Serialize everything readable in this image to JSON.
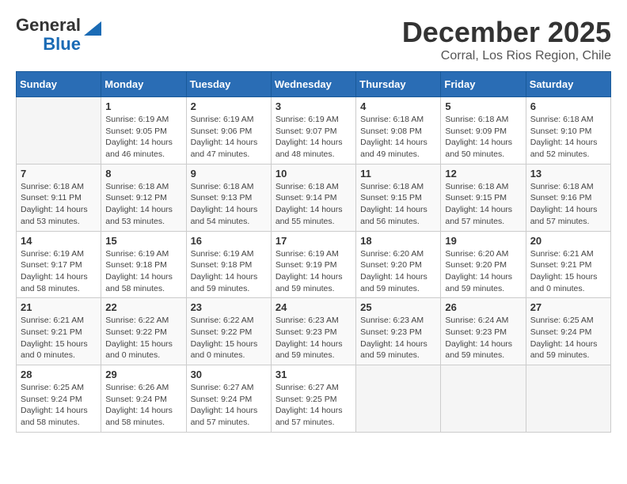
{
  "logo": {
    "line1": "General",
    "line2": "Blue"
  },
  "title": "December 2025",
  "location": "Corral, Los Rios Region, Chile",
  "days_of_week": [
    "Sunday",
    "Monday",
    "Tuesday",
    "Wednesday",
    "Thursday",
    "Friday",
    "Saturday"
  ],
  "weeks": [
    [
      {
        "day": "",
        "sunrise": "",
        "sunset": "",
        "daylight": ""
      },
      {
        "day": "1",
        "sunrise": "Sunrise: 6:19 AM",
        "sunset": "Sunset: 9:05 PM",
        "daylight": "Daylight: 14 hours and 46 minutes."
      },
      {
        "day": "2",
        "sunrise": "Sunrise: 6:19 AM",
        "sunset": "Sunset: 9:06 PM",
        "daylight": "Daylight: 14 hours and 47 minutes."
      },
      {
        "day": "3",
        "sunrise": "Sunrise: 6:19 AM",
        "sunset": "Sunset: 9:07 PM",
        "daylight": "Daylight: 14 hours and 48 minutes."
      },
      {
        "day": "4",
        "sunrise": "Sunrise: 6:18 AM",
        "sunset": "Sunset: 9:08 PM",
        "daylight": "Daylight: 14 hours and 49 minutes."
      },
      {
        "day": "5",
        "sunrise": "Sunrise: 6:18 AM",
        "sunset": "Sunset: 9:09 PM",
        "daylight": "Daylight: 14 hours and 50 minutes."
      },
      {
        "day": "6",
        "sunrise": "Sunrise: 6:18 AM",
        "sunset": "Sunset: 9:10 PM",
        "daylight": "Daylight: 14 hours and 52 minutes."
      }
    ],
    [
      {
        "day": "7",
        "sunrise": "Sunrise: 6:18 AM",
        "sunset": "Sunset: 9:11 PM",
        "daylight": "Daylight: 14 hours and 53 minutes."
      },
      {
        "day": "8",
        "sunrise": "Sunrise: 6:18 AM",
        "sunset": "Sunset: 9:12 PM",
        "daylight": "Daylight: 14 hours and 53 minutes."
      },
      {
        "day": "9",
        "sunrise": "Sunrise: 6:18 AM",
        "sunset": "Sunset: 9:13 PM",
        "daylight": "Daylight: 14 hours and 54 minutes."
      },
      {
        "day": "10",
        "sunrise": "Sunrise: 6:18 AM",
        "sunset": "Sunset: 9:14 PM",
        "daylight": "Daylight: 14 hours and 55 minutes."
      },
      {
        "day": "11",
        "sunrise": "Sunrise: 6:18 AM",
        "sunset": "Sunset: 9:15 PM",
        "daylight": "Daylight: 14 hours and 56 minutes."
      },
      {
        "day": "12",
        "sunrise": "Sunrise: 6:18 AM",
        "sunset": "Sunset: 9:15 PM",
        "daylight": "Daylight: 14 hours and 57 minutes."
      },
      {
        "day": "13",
        "sunrise": "Sunrise: 6:18 AM",
        "sunset": "Sunset: 9:16 PM",
        "daylight": "Daylight: 14 hours and 57 minutes."
      }
    ],
    [
      {
        "day": "14",
        "sunrise": "Sunrise: 6:19 AM",
        "sunset": "Sunset: 9:17 PM",
        "daylight": "Daylight: 14 hours and 58 minutes."
      },
      {
        "day": "15",
        "sunrise": "Sunrise: 6:19 AM",
        "sunset": "Sunset: 9:18 PM",
        "daylight": "Daylight: 14 hours and 58 minutes."
      },
      {
        "day": "16",
        "sunrise": "Sunrise: 6:19 AM",
        "sunset": "Sunset: 9:18 PM",
        "daylight": "Daylight: 14 hours and 59 minutes."
      },
      {
        "day": "17",
        "sunrise": "Sunrise: 6:19 AM",
        "sunset": "Sunset: 9:19 PM",
        "daylight": "Daylight: 14 hours and 59 minutes."
      },
      {
        "day": "18",
        "sunrise": "Sunrise: 6:20 AM",
        "sunset": "Sunset: 9:20 PM",
        "daylight": "Daylight: 14 hours and 59 minutes."
      },
      {
        "day": "19",
        "sunrise": "Sunrise: 6:20 AM",
        "sunset": "Sunset: 9:20 PM",
        "daylight": "Daylight: 14 hours and 59 minutes."
      },
      {
        "day": "20",
        "sunrise": "Sunrise: 6:21 AM",
        "sunset": "Sunset: 9:21 PM",
        "daylight": "Daylight: 15 hours and 0 minutes."
      }
    ],
    [
      {
        "day": "21",
        "sunrise": "Sunrise: 6:21 AM",
        "sunset": "Sunset: 9:21 PM",
        "daylight": "Daylight: 15 hours and 0 minutes."
      },
      {
        "day": "22",
        "sunrise": "Sunrise: 6:22 AM",
        "sunset": "Sunset: 9:22 PM",
        "daylight": "Daylight: 15 hours and 0 minutes."
      },
      {
        "day": "23",
        "sunrise": "Sunrise: 6:22 AM",
        "sunset": "Sunset: 9:22 PM",
        "daylight": "Daylight: 15 hours and 0 minutes."
      },
      {
        "day": "24",
        "sunrise": "Sunrise: 6:23 AM",
        "sunset": "Sunset: 9:23 PM",
        "daylight": "Daylight: 14 hours and 59 minutes."
      },
      {
        "day": "25",
        "sunrise": "Sunrise: 6:23 AM",
        "sunset": "Sunset: 9:23 PM",
        "daylight": "Daylight: 14 hours and 59 minutes."
      },
      {
        "day": "26",
        "sunrise": "Sunrise: 6:24 AM",
        "sunset": "Sunset: 9:23 PM",
        "daylight": "Daylight: 14 hours and 59 minutes."
      },
      {
        "day": "27",
        "sunrise": "Sunrise: 6:25 AM",
        "sunset": "Sunset: 9:24 PM",
        "daylight": "Daylight: 14 hours and 59 minutes."
      }
    ],
    [
      {
        "day": "28",
        "sunrise": "Sunrise: 6:25 AM",
        "sunset": "Sunset: 9:24 PM",
        "daylight": "Daylight: 14 hours and 58 minutes."
      },
      {
        "day": "29",
        "sunrise": "Sunrise: 6:26 AM",
        "sunset": "Sunset: 9:24 PM",
        "daylight": "Daylight: 14 hours and 58 minutes."
      },
      {
        "day": "30",
        "sunrise": "Sunrise: 6:27 AM",
        "sunset": "Sunset: 9:24 PM",
        "daylight": "Daylight: 14 hours and 57 minutes."
      },
      {
        "day": "31",
        "sunrise": "Sunrise: 6:27 AM",
        "sunset": "Sunset: 9:25 PM",
        "daylight": "Daylight: 14 hours and 57 minutes."
      },
      {
        "day": "",
        "sunrise": "",
        "sunset": "",
        "daylight": ""
      },
      {
        "day": "",
        "sunrise": "",
        "sunset": "",
        "daylight": ""
      },
      {
        "day": "",
        "sunrise": "",
        "sunset": "",
        "daylight": ""
      }
    ]
  ]
}
